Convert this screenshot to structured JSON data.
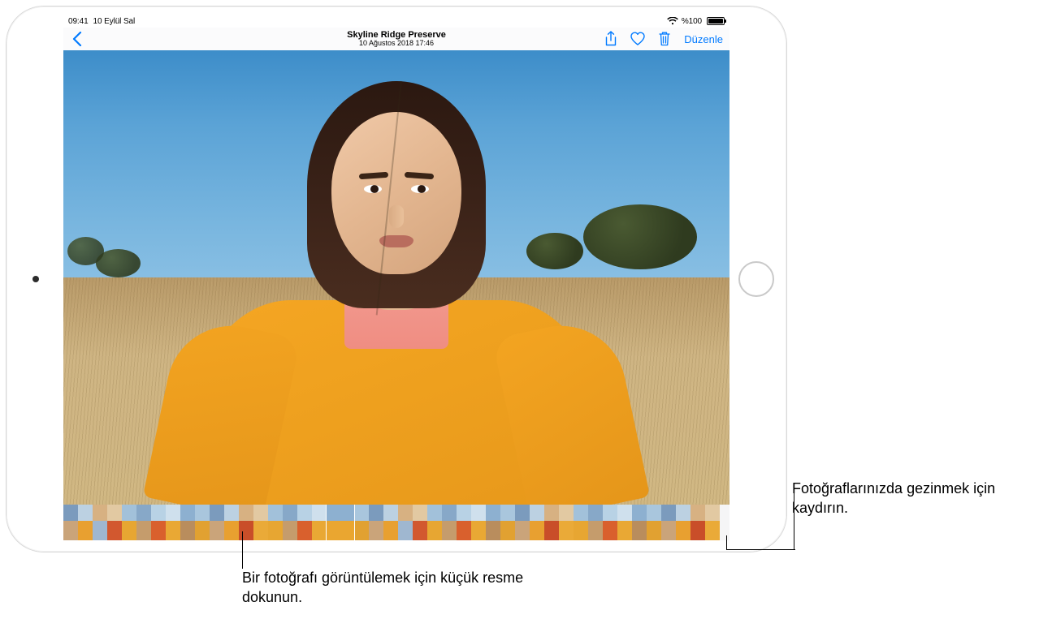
{
  "status": {
    "time": "09:41",
    "date": "10 Eylül Sal",
    "battery_text": "%100"
  },
  "nav": {
    "title": "Skyline Ridge Preserve",
    "subtitle": "10 Ağustos 2018 17:46",
    "edit_label": "Düzenle"
  },
  "icons": {
    "back": "back-chevron-icon",
    "share": "share-icon",
    "favorite": "heart-icon",
    "delete": "trash-icon",
    "wifi": "wifi-icon",
    "battery": "battery-icon"
  },
  "thumbnails": [
    {
      "c1": "#caa47a",
      "c2": "#7b9bbd"
    },
    {
      "c1": "#e8a030",
      "c2": "#bcd1e2"
    },
    {
      "c1": "#9fb7d0",
      "c2": "#d7b182"
    },
    {
      "c1": "#d2582f",
      "c2": "#e2c9a2"
    },
    {
      "c1": "#e7a632",
      "c2": "#a2c1da"
    },
    {
      "c1": "#c59c6c",
      "c2": "#87a8c8"
    },
    {
      "c1": "#d9602d",
      "c2": "#b8d2e5"
    },
    {
      "c1": "#e9a834",
      "c2": "#cfe0ed"
    },
    {
      "c1": "#b98d5d",
      "c2": "#8db0d0"
    },
    {
      "c1": "#e1a131",
      "c2": "#a9c6dd"
    },
    {
      "c1": "#caa47a",
      "c2": "#7b9bbd"
    },
    {
      "c1": "#e8a030",
      "c2": "#bcd1e2"
    },
    {
      "c1": "#c94e29",
      "c2": "#d7b182"
    },
    {
      "c1": "#eaaa38",
      "c2": "#e2c9a2"
    },
    {
      "c1": "#e7a632",
      "c2": "#a2c1da"
    },
    {
      "c1": "#c59c6c",
      "c2": "#87a8c8"
    },
    {
      "c1": "#d9602d",
      "c2": "#b8d2e5"
    },
    {
      "c1": "#e9a834",
      "c2": "#cfe0ed"
    },
    {
      "c1": "#eaa630",
      "c2": "#8db0d0",
      "selected": true
    },
    {
      "c1": "#e1a131",
      "c2": "#a9c6dd"
    },
    {
      "c1": "#caa47a",
      "c2": "#7b9bbd"
    },
    {
      "c1": "#e8a030",
      "c2": "#bcd1e2"
    },
    {
      "c1": "#9fb7d0",
      "c2": "#d7b182"
    },
    {
      "c1": "#d2582f",
      "c2": "#e2c9a2"
    },
    {
      "c1": "#e7a632",
      "c2": "#a2c1da"
    },
    {
      "c1": "#c59c6c",
      "c2": "#87a8c8"
    },
    {
      "c1": "#d9602d",
      "c2": "#b8d2e5"
    },
    {
      "c1": "#e9a834",
      "c2": "#cfe0ed"
    },
    {
      "c1": "#b98d5d",
      "c2": "#8db0d0"
    },
    {
      "c1": "#e1a131",
      "c2": "#a9c6dd"
    },
    {
      "c1": "#caa47a",
      "c2": "#7b9bbd"
    },
    {
      "c1": "#e8a030",
      "c2": "#bcd1e2"
    },
    {
      "c1": "#c94e29",
      "c2": "#d7b182"
    },
    {
      "c1": "#eaaa38",
      "c2": "#e2c9a2"
    },
    {
      "c1": "#e7a632",
      "c2": "#a2c1da"
    },
    {
      "c1": "#c59c6c",
      "c2": "#87a8c8"
    },
    {
      "c1": "#d9602d",
      "c2": "#b8d2e5"
    },
    {
      "c1": "#e9a834",
      "c2": "#cfe0ed"
    },
    {
      "c1": "#b98d5d",
      "c2": "#8db0d0"
    },
    {
      "c1": "#e1a131",
      "c2": "#a9c6dd"
    },
    {
      "c1": "#caa47a",
      "c2": "#7b9bbd"
    },
    {
      "c1": "#e8a030",
      "c2": "#bcd1e2"
    },
    {
      "c1": "#c94e29",
      "c2": "#d7b182"
    },
    {
      "c1": "#eaaa38",
      "c2": "#e2c9a2"
    }
  ],
  "callouts": {
    "tap_thumbnail": "Bir fotoğrafı görüntülemek için küçük resme dokunun.",
    "swipe_browse": "Fotoğraflarınızda gezinmek için kaydırın."
  }
}
